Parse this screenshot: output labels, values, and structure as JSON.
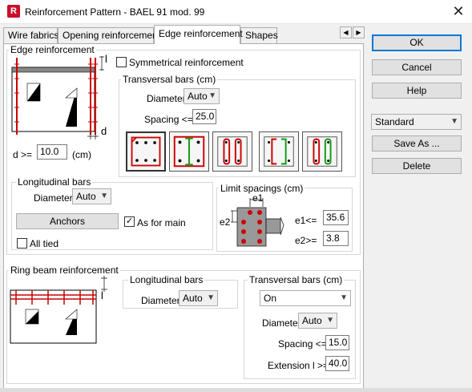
{
  "window": {
    "title": "Reinforcement Pattern - BAEL 91 mod. 99",
    "app_icon": "R"
  },
  "tabs": [
    "Wire fabrics",
    "Opening reinforcement",
    "Edge reinforcement",
    "Shapes"
  ],
  "edge": {
    "group_label": "Edge reinforcement",
    "symmetrical_label": "Symmetrical reinforcement",
    "diagram_l_label": "l",
    "diagram_d_label": "d",
    "d_label": "d >=",
    "d_value": "10.0",
    "d_unit": "(cm)",
    "transversal": {
      "label": "Transversal bars (cm)",
      "diameter_label": "Diameter",
      "diameter_value": "Auto",
      "spacing_label": "Spacing <=",
      "spacing_value": "25.0"
    },
    "longitudinal": {
      "label": "Longitudinal bars",
      "diameter_label": "Diameter",
      "diameter_value": "Auto",
      "anchors_label": "Anchors",
      "as_for_main_label": "As for main",
      "as_for_main_checked": true,
      "all_tied_label": "All tied",
      "all_tied_checked": false
    },
    "limit": {
      "label": "Limit spacings (cm)",
      "e1_tag": "e1",
      "e2_tag": "e2",
      "e1_label": "e1<=",
      "e1_value": "35.6",
      "e2_label": "e2>=",
      "e2_value": "3.8"
    }
  },
  "ring": {
    "group_label": "Ring beam reinforcement",
    "diagram_l_label": "l",
    "longitudinal": {
      "label": "Longitudinal bars",
      "diameter_label": "Diameter",
      "diameter_value": "Auto"
    },
    "transversal": {
      "label": "Transversal bars (cm)",
      "mode_value": "On",
      "diameter_label": "Diameter",
      "diameter_value": "Auto",
      "spacing_label": "Spacing <=",
      "spacing_value": "15.0",
      "extension_label": "Extension l >=",
      "extension_value": "40.0"
    }
  },
  "side": {
    "ok": "OK",
    "cancel": "Cancel",
    "help": "Help",
    "preset": "Standard",
    "save_as": "Save As ...",
    "delete": "Delete"
  },
  "colors": {
    "bar_red": "#cc0000",
    "bar_green": "#119911",
    "accent": "#0078d7",
    "brand": "#c8102e"
  }
}
